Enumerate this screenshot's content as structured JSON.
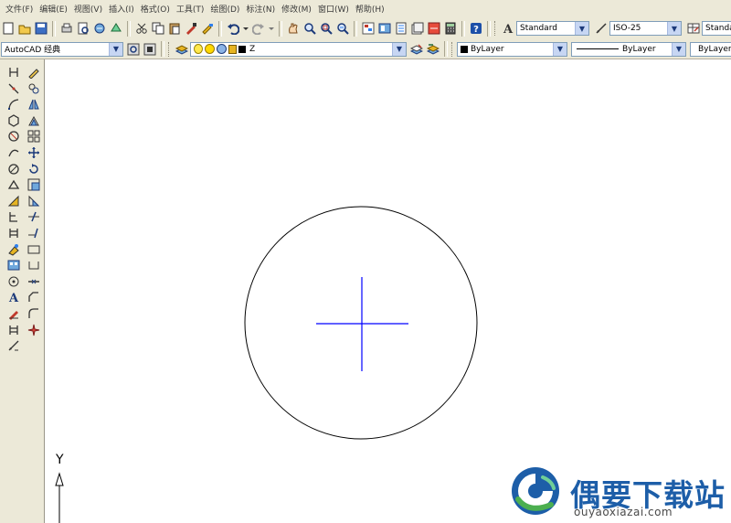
{
  "menu": [
    "文件(F)",
    "编辑(E)",
    "视图(V)",
    "插入(I)",
    "格式(O)",
    "工具(T)",
    "绘图(D)",
    "标注(N)",
    "修改(M)",
    "窗口(W)",
    "帮助(H)"
  ],
  "styles": {
    "text_style": "Standard",
    "dim_style": "ISO-25",
    "table_style": "Standard"
  },
  "workspace": "AutoCAD 经典",
  "layer": "Z",
  "properties": {
    "color": "ByLayer",
    "linetype": "ByLayer",
    "lineweight": "ByLayer"
  },
  "canvas": {
    "ucs_axis_label": "Y",
    "accent_color": "#0000ff"
  },
  "watermark": {
    "title": "偶要下载站",
    "url": "ouyaoxiazai.com"
  }
}
